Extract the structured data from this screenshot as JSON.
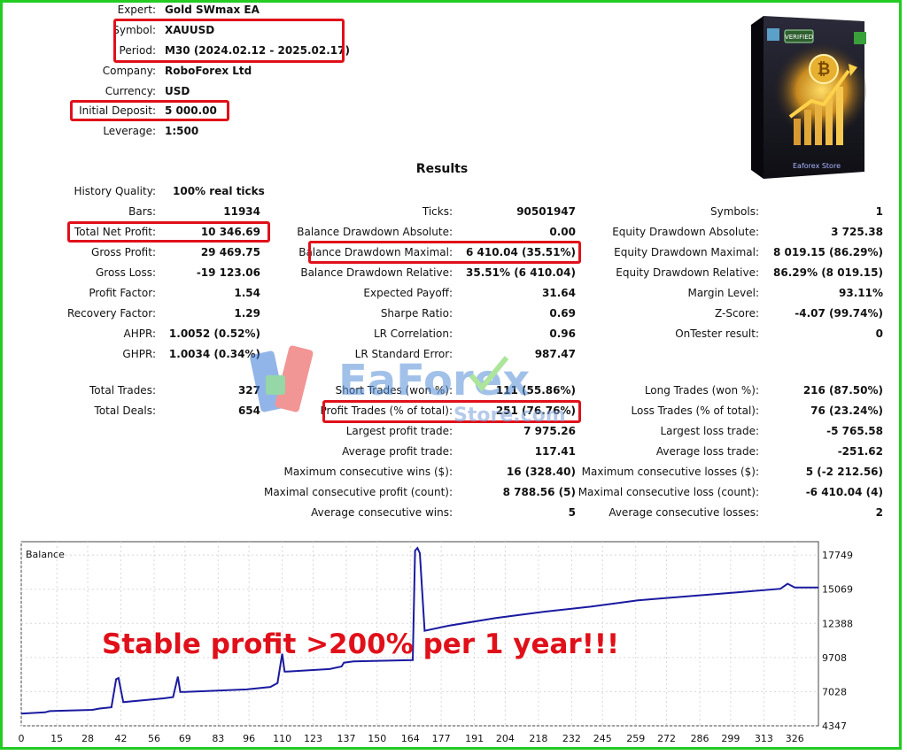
{
  "header": [
    {
      "label": "Expert:",
      "value": "Gold SWmax EA"
    },
    {
      "label": "Symbol:",
      "value": "XAUUSD"
    },
    {
      "label": "Period:",
      "value": "M30 (2024.02.12 - 2025.02.17)"
    },
    {
      "label": "Company:",
      "value": "RoboForex Ltd"
    },
    {
      "label": "Currency:",
      "value": "USD"
    },
    {
      "label": "Initial Deposit:",
      "value": "5 000.00"
    },
    {
      "label": "Leverage:",
      "value": "1:500"
    }
  ],
  "results_title": "Results",
  "history_quality": {
    "label": "History Quality:",
    "value": "100% real ticks"
  },
  "col1": [
    {
      "label": "Bars:",
      "value": "11934"
    },
    {
      "label": "Total Net Profit:",
      "value": "10 346.69"
    },
    {
      "label": "Gross Profit:",
      "value": "29 469.75"
    },
    {
      "label": "Gross Loss:",
      "value": "-19 123.06"
    },
    {
      "label": "Profit Factor:",
      "value": "1.54"
    },
    {
      "label": "Recovery Factor:",
      "value": "1.29"
    },
    {
      "label": "AHPR:",
      "value": "1.0052 (0.52%)"
    },
    {
      "label": "GHPR:",
      "value": "1.0034 (0.34%)"
    }
  ],
  "col2": [
    {
      "label": "Ticks:",
      "value": "90501947"
    },
    {
      "label": "Balance Drawdown Absolute:",
      "value": "0.00"
    },
    {
      "label": "Balance Drawdown Maximal:",
      "value": "6 410.04 (35.51%)"
    },
    {
      "label": "Balance Drawdown Relative:",
      "value": "35.51% (6 410.04)"
    },
    {
      "label": "Expected Payoff:",
      "value": "31.64"
    },
    {
      "label": "Sharpe Ratio:",
      "value": "0.69"
    },
    {
      "label": "LR Correlation:",
      "value": "0.96"
    },
    {
      "label": "LR Standard Error:",
      "value": "987.47"
    }
  ],
  "col3": [
    {
      "label": "Symbols:",
      "value": "1"
    },
    {
      "label": "Equity Drawdown Absolute:",
      "value": "3 725.38"
    },
    {
      "label": "Equity Drawdown Maximal:",
      "value": "8 019.15 (86.29%)"
    },
    {
      "label": "Equity Drawdown Relative:",
      "value": "86.29% (8 019.15)"
    },
    {
      "label": "Margin Level:",
      "value": "93.11%"
    },
    {
      "label": "Z-Score:",
      "value": "-4.07 (99.74%)"
    },
    {
      "label": "OnTester result:",
      "value": "0"
    }
  ],
  "trades_col1": [
    {
      "label": "Total Trades:",
      "value": "327"
    },
    {
      "label": "Total Deals:",
      "value": "654"
    }
  ],
  "trades_col2": [
    {
      "label": "Short Trades (won %):",
      "value": "111 (55.86%)"
    },
    {
      "label": "Profit Trades (% of total):",
      "value": "251 (76.76%)"
    },
    {
      "label": "Largest profit trade:",
      "value": "7 975.26"
    },
    {
      "label": "Average profit trade:",
      "value": "117.41"
    },
    {
      "label": "Maximum consecutive wins ($):",
      "value": "16 (328.40)"
    },
    {
      "label": "Maximal consecutive profit (count):",
      "value": "8 788.56 (5)"
    },
    {
      "label": "Average consecutive wins:",
      "value": "5"
    }
  ],
  "trades_col3": [
    {
      "label": "Long Trades (won %):",
      "value": "216 (87.50%)"
    },
    {
      "label": "Loss Trades (% of total):",
      "value": "76 (23.24%)"
    },
    {
      "label": "Largest loss trade:",
      "value": "-5 765.58"
    },
    {
      "label": "Average loss trade:",
      "value": "-251.62"
    },
    {
      "label": "Maximum consecutive losses ($):",
      "value": "5 (-2 212.56)"
    },
    {
      "label": "Maximal consecutive loss (count):",
      "value": "-6 410.04 (4)"
    },
    {
      "label": "Average consecutive losses:",
      "value": "2"
    }
  ],
  "watermark": {
    "brand": "EaForex",
    "sub": "Store.com"
  },
  "product": {
    "badge": "VERIFIED",
    "name": "Eaforex Store"
  },
  "promo_text": "Stable profit >200% per 1 year!!!",
  "colors": {
    "highlight_box": "#e0101a",
    "frame": "#22cc22",
    "balance_line": "#1a1aa0",
    "promo": "#e0101a"
  },
  "chart_data": {
    "type": "line",
    "title": "Balance",
    "x_ticks": [
      0,
      15,
      28,
      42,
      56,
      69,
      83,
      96,
      110,
      123,
      137,
      150,
      164,
      177,
      191,
      204,
      218,
      232,
      245,
      259,
      272,
      286,
      299,
      313,
      326
    ],
    "y_ticks": [
      4347,
      7028,
      9708,
      12388,
      15069,
      17749
    ],
    "xlim": [
      0,
      336
    ],
    "ylim": [
      4347,
      18800
    ],
    "grid": true,
    "series": [
      {
        "x": [
          0,
          10,
          12,
          30,
          33,
          38,
          40,
          41,
          43,
          60,
          64,
          66,
          67,
          69,
          95,
          100,
          105,
          108,
          110,
          111,
          112,
          130,
          135,
          136,
          140,
          165,
          166,
          167,
          168,
          170,
          180,
          200,
          220,
          240,
          260,
          280,
          300,
          320,
          323,
          326,
          336
        ],
        "y": [
          5300,
          5400,
          5500,
          5600,
          5700,
          5800,
          8000,
          8100,
          6200,
          6500,
          6600,
          8200,
          7000,
          7000,
          7200,
          7300,
          7400,
          7700,
          10000,
          8600,
          8600,
          8800,
          9000,
          9300,
          9400,
          9500,
          18100,
          18300,
          17900,
          11800,
          12200,
          12800,
          13300,
          13700,
          14200,
          14500,
          14800,
          15100,
          15500,
          15200,
          15200
        ]
      }
    ]
  }
}
